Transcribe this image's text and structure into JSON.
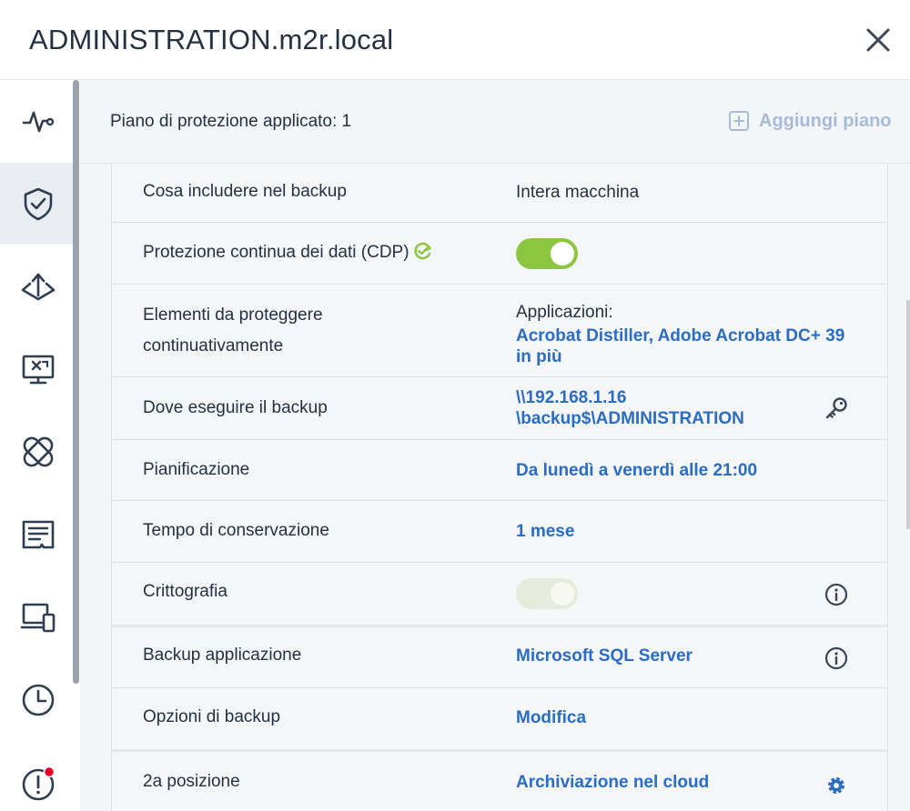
{
  "window": {
    "title": "ADMINISTRATION.m2r.local"
  },
  "sidebar": {
    "items": [
      {
        "icon": "activity-icon"
      },
      {
        "icon": "shield-check-icon",
        "active": true
      },
      {
        "icon": "recovery-icon"
      },
      {
        "icon": "remote-desktop-icon"
      },
      {
        "icon": "patch-icon"
      },
      {
        "icon": "report-icon"
      },
      {
        "icon": "devices-icon"
      },
      {
        "icon": "history-icon"
      },
      {
        "icon": "alert-icon"
      }
    ]
  },
  "main": {
    "applied_label": "Piano di protezione applicato: 1",
    "add_plan_label": "Aggiungi piano"
  },
  "rows": {
    "what": {
      "label": "Cosa includere nel backup",
      "value": "Intera macchina"
    },
    "cdp": {
      "label": "Protezione continua dei dati (CDP)",
      "toggle": "on"
    },
    "items": {
      "label_1": "Elementi da proteggere",
      "label_2": "continuativamente",
      "value_heading": "Applicazioni:",
      "value_line1": "Acrobat Distiller, Adobe Acrobat DC+ 39",
      "value_line2": "in più"
    },
    "where": {
      "label": "Dove eseguire il backup",
      "value_line1": "\\\\192.168.1.16",
      "value_line2": "\\backup$\\ADMINISTRATION"
    },
    "schedule": {
      "label": "Pianificazione",
      "value": "Da lunedì a venerdì alle 21:00"
    },
    "retention": {
      "label": "Tempo di conservazione",
      "value": "1 mese"
    },
    "encryption": {
      "label": "Crittografia",
      "toggle": "disabled"
    },
    "app_backup": {
      "label": "Backup applicazione",
      "value": "Microsoft SQL Server"
    },
    "options": {
      "label": "Opzioni di backup",
      "value": "Modifica"
    },
    "second_location": {
      "label": "2a posizione",
      "value": "Archiviazione nel cloud"
    }
  },
  "colors": {
    "accent": "#2b6cc4",
    "toggle_on": "#8cc63e",
    "alert_dot": "#e4002b",
    "text": "#243143"
  }
}
